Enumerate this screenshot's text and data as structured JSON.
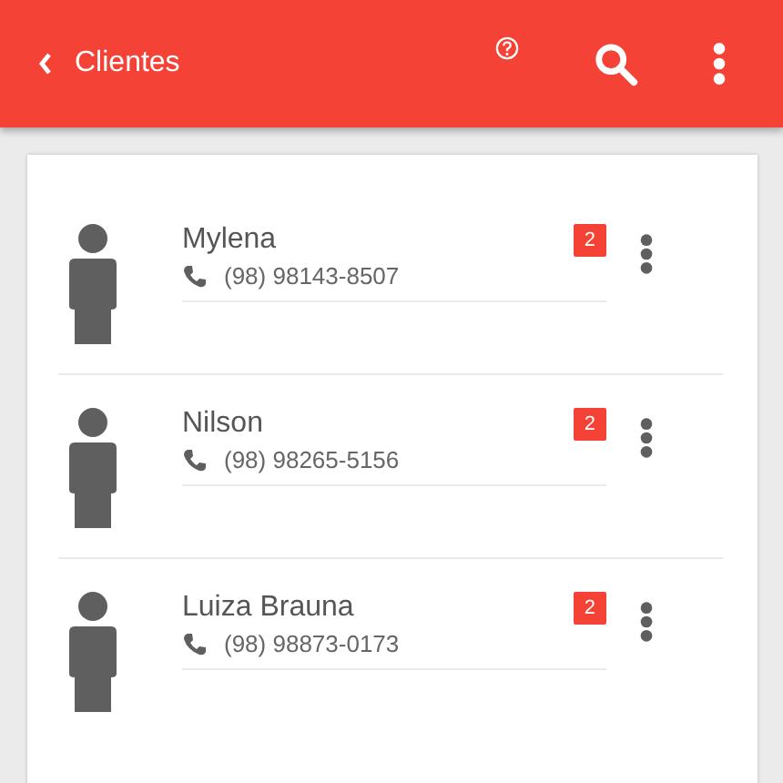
{
  "app_bar": {
    "title": "Clientes"
  },
  "clients": [
    {
      "name": "Mylena",
      "phone": "(98) 98143-8507",
      "badge": "2"
    },
    {
      "name": "Nilson",
      "phone": "(98) 98265-5156",
      "badge": "2"
    },
    {
      "name": "Luiza Brauna",
      "phone": "(98) 98873-0173",
      "badge": "2"
    }
  ]
}
